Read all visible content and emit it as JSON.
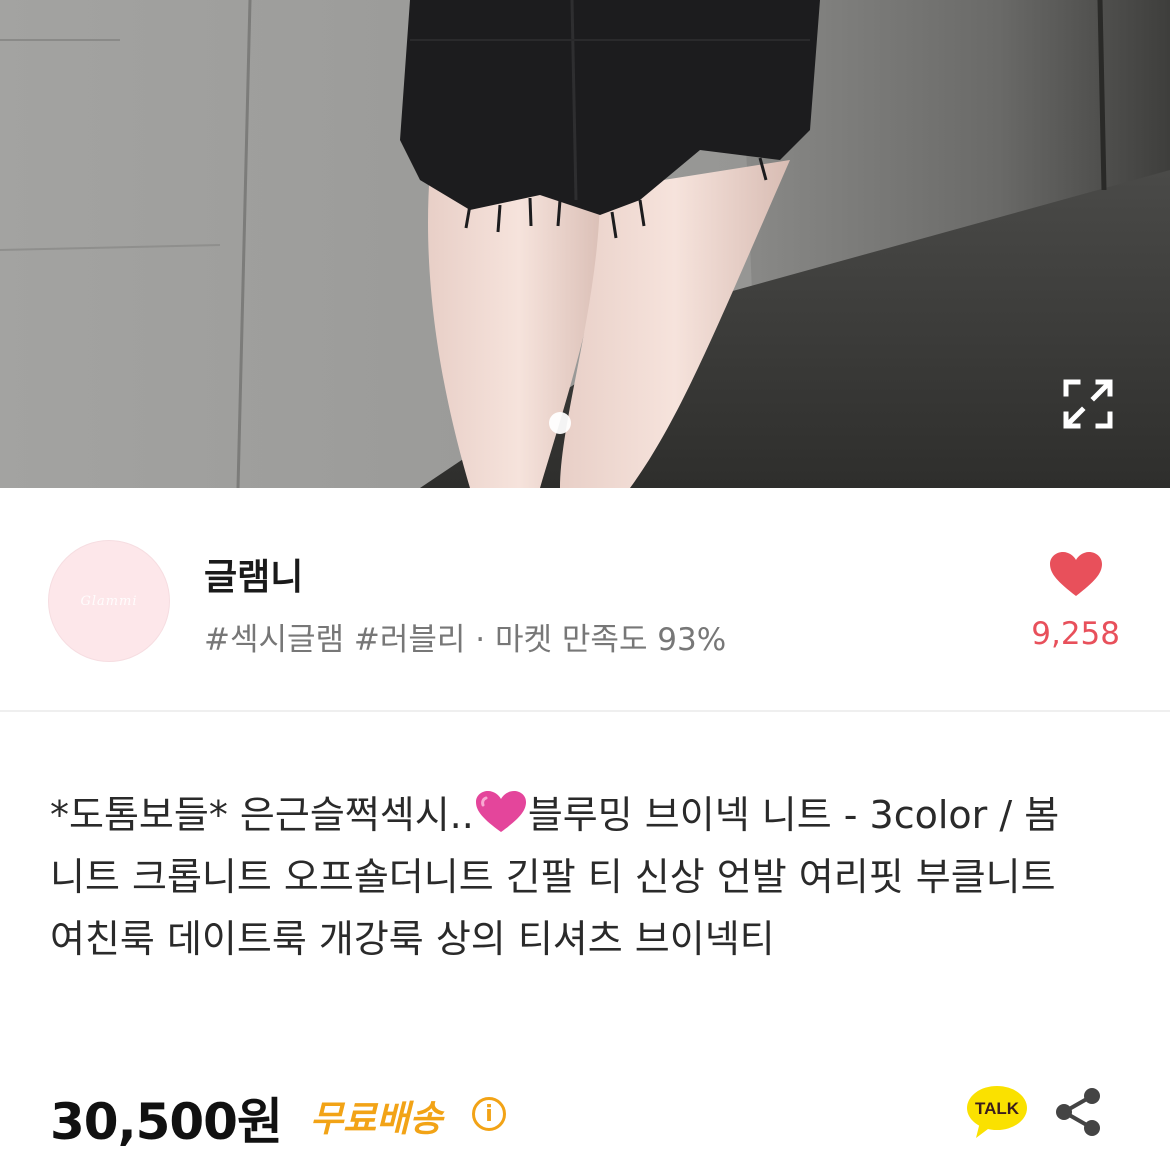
{
  "product": {
    "image_alt": "product photo",
    "slide_indicator": "1 of 1"
  },
  "seller": {
    "avatar_text": "Glammi",
    "name": "글램니",
    "tags": "#섹시글램 #러블리 · 마켓 만족도 93%",
    "likes": "9,258"
  },
  "title": {
    "part1": "*도톰보들* 은근슬쩍섹시..",
    "part2": "블루밍 브이넥 니트 - 3color / 봄 니트 크롭니트 오프숄더니트 긴팔 티 신상 언발 여리핏 부클니트 여친룩 데이트룩 개강룩 상의 티셔츠 브이넥티"
  },
  "price": {
    "amount": "30,500원",
    "shipping": "무료배송",
    "info_glyph": "i"
  },
  "actions": {
    "talk_label": "TALK"
  },
  "colors": {
    "accent_pink": "#e8505b",
    "shipping_orange": "#f2a316",
    "kakao_yellow": "#fae100"
  },
  "icons": [
    "expand-icon",
    "heart-icon",
    "info-icon",
    "kakao-talk-icon",
    "share-icon"
  ]
}
